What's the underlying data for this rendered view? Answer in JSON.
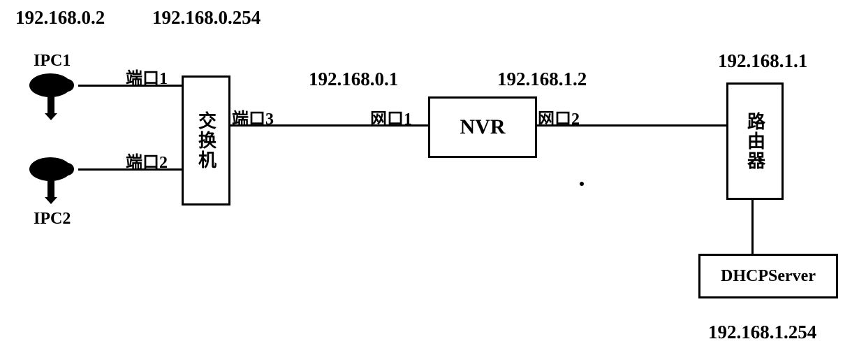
{
  "title_ips": {
    "ipc1_ip": "192.168.0.2",
    "switch_ip": "192.168.0.254",
    "nvr_left_ip": "192.168.0.1",
    "nvr_right_ip": "192.168.1.2",
    "router_ip": "192.168.1.1",
    "dhcp_ip": "192.168.1.254"
  },
  "devices": {
    "ipc1": "IPC1",
    "ipc2": "IPC2",
    "switch": "交换机",
    "nvr": "NVR",
    "router": "路由器",
    "dhcp": "DHCPServer"
  },
  "ports": {
    "port1": "端口1",
    "port2": "端口2",
    "port3": "端口3",
    "net1": "网口1",
    "net2": "网口2"
  },
  "font": {
    "ip": "27px",
    "device": "24px",
    "port": "24px",
    "nvr": "30px",
    "box": "26px"
  }
}
